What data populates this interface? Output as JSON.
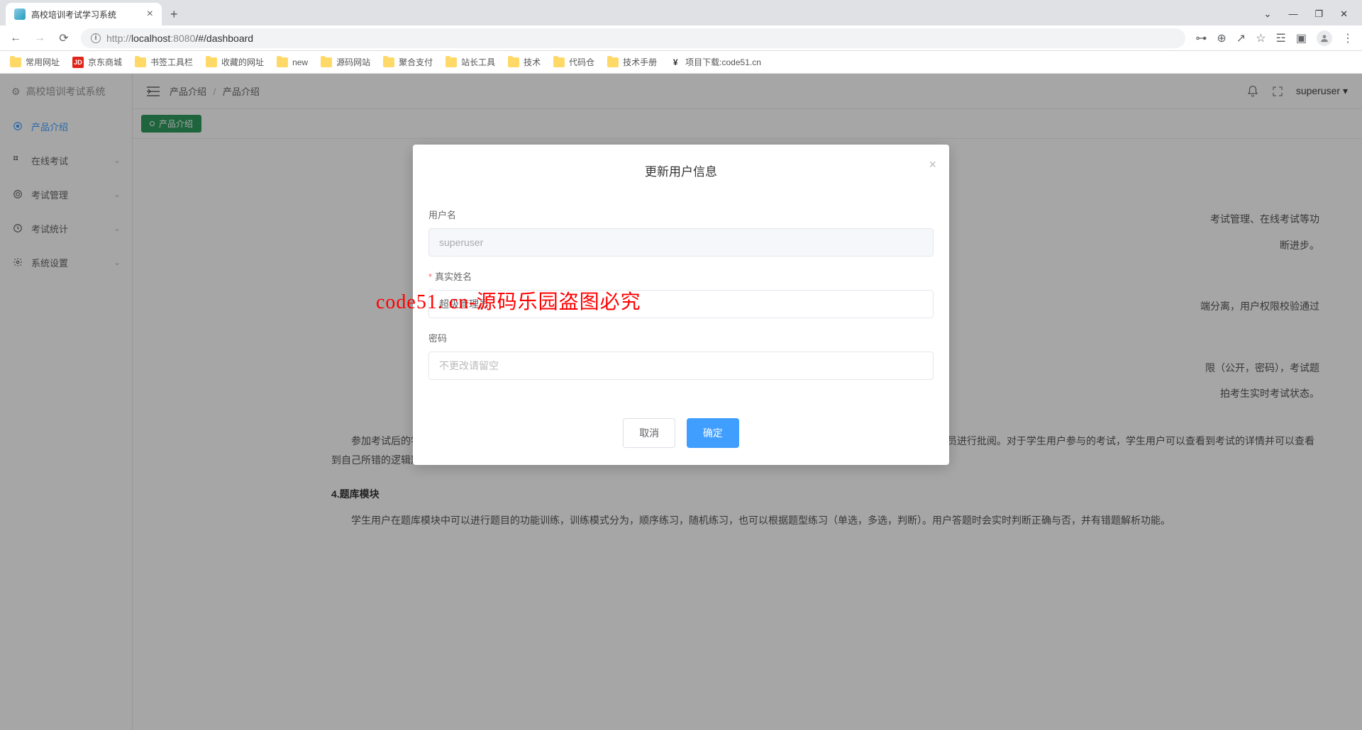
{
  "browser": {
    "tab_title": "高校培训考试学习系统",
    "url_host": "localhost",
    "url_port": ":8080",
    "url_path": "/#/dashboard",
    "url_protocol": "http://"
  },
  "bookmarks": [
    {
      "label": "常用网址",
      "icon": "folder"
    },
    {
      "label": "京东商城",
      "icon": "jd"
    },
    {
      "label": "书签工具栏",
      "icon": "folder"
    },
    {
      "label": "收藏的网址",
      "icon": "folder"
    },
    {
      "label": "new",
      "icon": "folder"
    },
    {
      "label": "源码网站",
      "icon": "folder"
    },
    {
      "label": "聚合支付",
      "icon": "folder"
    },
    {
      "label": "站长工具",
      "icon": "folder"
    },
    {
      "label": "技术",
      "icon": "folder"
    },
    {
      "label": "代码仓",
      "icon": "folder"
    },
    {
      "label": "技术手册",
      "icon": "folder"
    },
    {
      "label": "项目下载:code51.cn",
      "icon": "yen"
    }
  ],
  "sidebar": {
    "logo_text": "高校培训考试系统",
    "items": [
      {
        "label": "产品介绍",
        "expandable": false,
        "active": true
      },
      {
        "label": "在线考试",
        "expandable": true,
        "active": false
      },
      {
        "label": "考试管理",
        "expandable": true,
        "active": false
      },
      {
        "label": "考试统计",
        "expandable": true,
        "active": false
      },
      {
        "label": "系统设置",
        "expandable": true,
        "active": false
      }
    ]
  },
  "topbar": {
    "breadcrumb": [
      "产品介绍",
      "产品介绍"
    ],
    "username": "superuser"
  },
  "tag": {
    "label": "产品介绍"
  },
  "content": {
    "p1_tail": "考试管理、在线考试等功",
    "p1_line2_tail": "断进步。",
    "p2_tail": "端分离，用户权限校验通过",
    "p3_tail1": "限（公开，密码），考试题",
    "p3_tail2": "拍考生实时考试状态。",
    "p4": "参加考试后的学生用户，在提交试卷后进入考试结果页面，页面会自动核对学生用户的逻辑题的对错，对于简答题需要老师或者超级管理员进行批阅。对于学生用户参与的考试，学生用户可以查看到考试的详情并可以查看到自己所错的逻辑题。",
    "h4": "4.题库模块",
    "p5": "学生用户在题库模块中可以进行题目的功能训练，训练模式分为，顺序练习，随机练习，也可以根据题型练习（单选，多选，判断）。用户答题时会实时判断正确与否，并有错题解析功能。"
  },
  "modal": {
    "title": "更新用户信息",
    "fields": {
      "username": {
        "label": "用户名",
        "value": "superuser"
      },
      "realname": {
        "label": "真实姓名",
        "value": "超级管理员",
        "required": true
      },
      "password": {
        "label": "密码",
        "placeholder": "不更改请留空"
      }
    },
    "buttons": {
      "cancel": "取消",
      "confirm": "确定"
    }
  },
  "watermark": "code51. cn-源码乐园盗图必究"
}
